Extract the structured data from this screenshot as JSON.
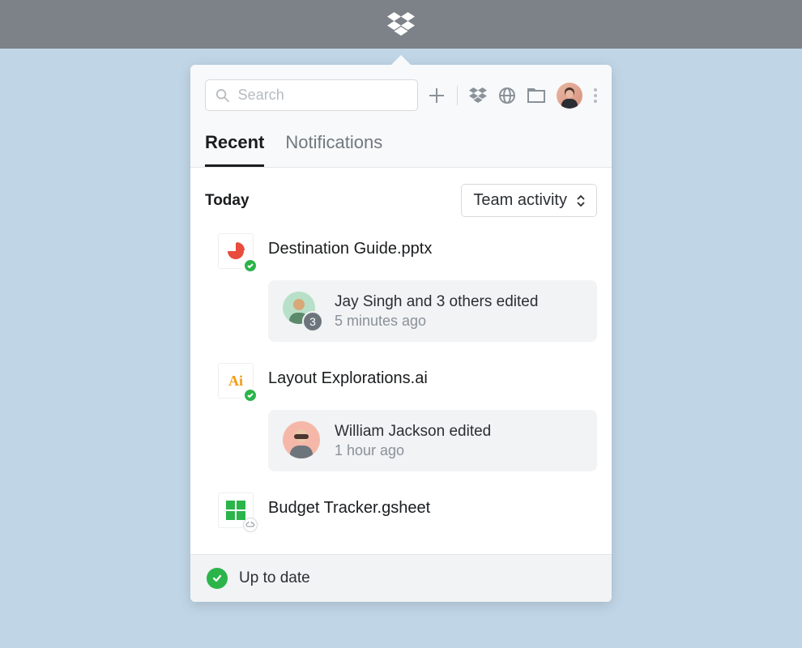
{
  "search": {
    "placeholder": "Search"
  },
  "tabs": [
    {
      "label": "Recent",
      "active": true
    },
    {
      "label": "Notifications",
      "active": false
    }
  ],
  "section": {
    "title": "Today",
    "filter": "Team activity"
  },
  "files": [
    {
      "name": "Destination Guide.pptx",
      "icon": "powerpoint-icon",
      "badge": "synced",
      "activity": {
        "avatar_count": "3",
        "primary": "Jay Singh and 3 others edited",
        "secondary": "5 minutes ago"
      }
    },
    {
      "name": "Layout Explorations.ai",
      "icon": "illustrator-icon",
      "badge": "synced",
      "activity": {
        "primary": "William Jackson edited",
        "secondary": "1 hour ago"
      }
    },
    {
      "name": "Budget Tracker.gsheet",
      "icon": "gsheet-icon",
      "badge": "cloud"
    }
  ],
  "footer": {
    "status": "Up to date"
  }
}
